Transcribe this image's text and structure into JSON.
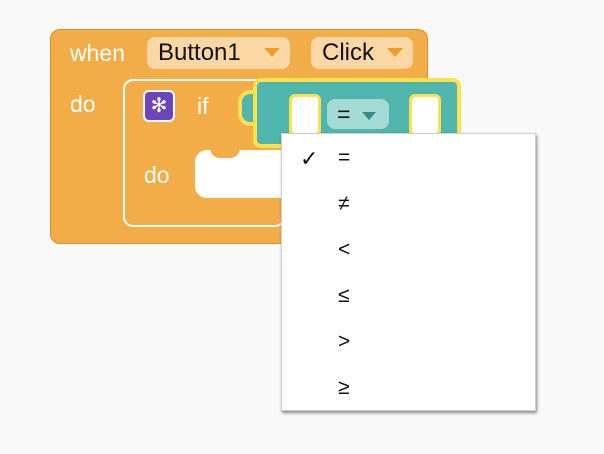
{
  "event_block": {
    "when_label": "when",
    "component": "Button1",
    "event": "Click",
    "do_label": "do"
  },
  "if_block": {
    "if_label": "if",
    "do_label": "do"
  },
  "logic_compare": {
    "selected_operator": "="
  },
  "dropdown": {
    "items": [
      {
        "label": "=",
        "checked": true
      },
      {
        "label": "≠",
        "checked": false
      },
      {
        "label": "<",
        "checked": false
      },
      {
        "label": "≤",
        "checked": false
      },
      {
        "label": ">",
        "checked": false
      },
      {
        "label": "≥",
        "checked": false
      }
    ],
    "check_glyph": "✓"
  },
  "colors": {
    "control_block": "#f3ad48",
    "logic_block": "#4fb5ad",
    "selection_outline": "#ffe14d",
    "mutator_button": "#6e45b9"
  },
  "icons": {
    "mutator": "gear-icon",
    "component_caret": "chevron-down-icon",
    "event_caret": "chevron-down-icon",
    "operator_caret": "chevron-down-icon",
    "checkmark": "check-icon"
  }
}
